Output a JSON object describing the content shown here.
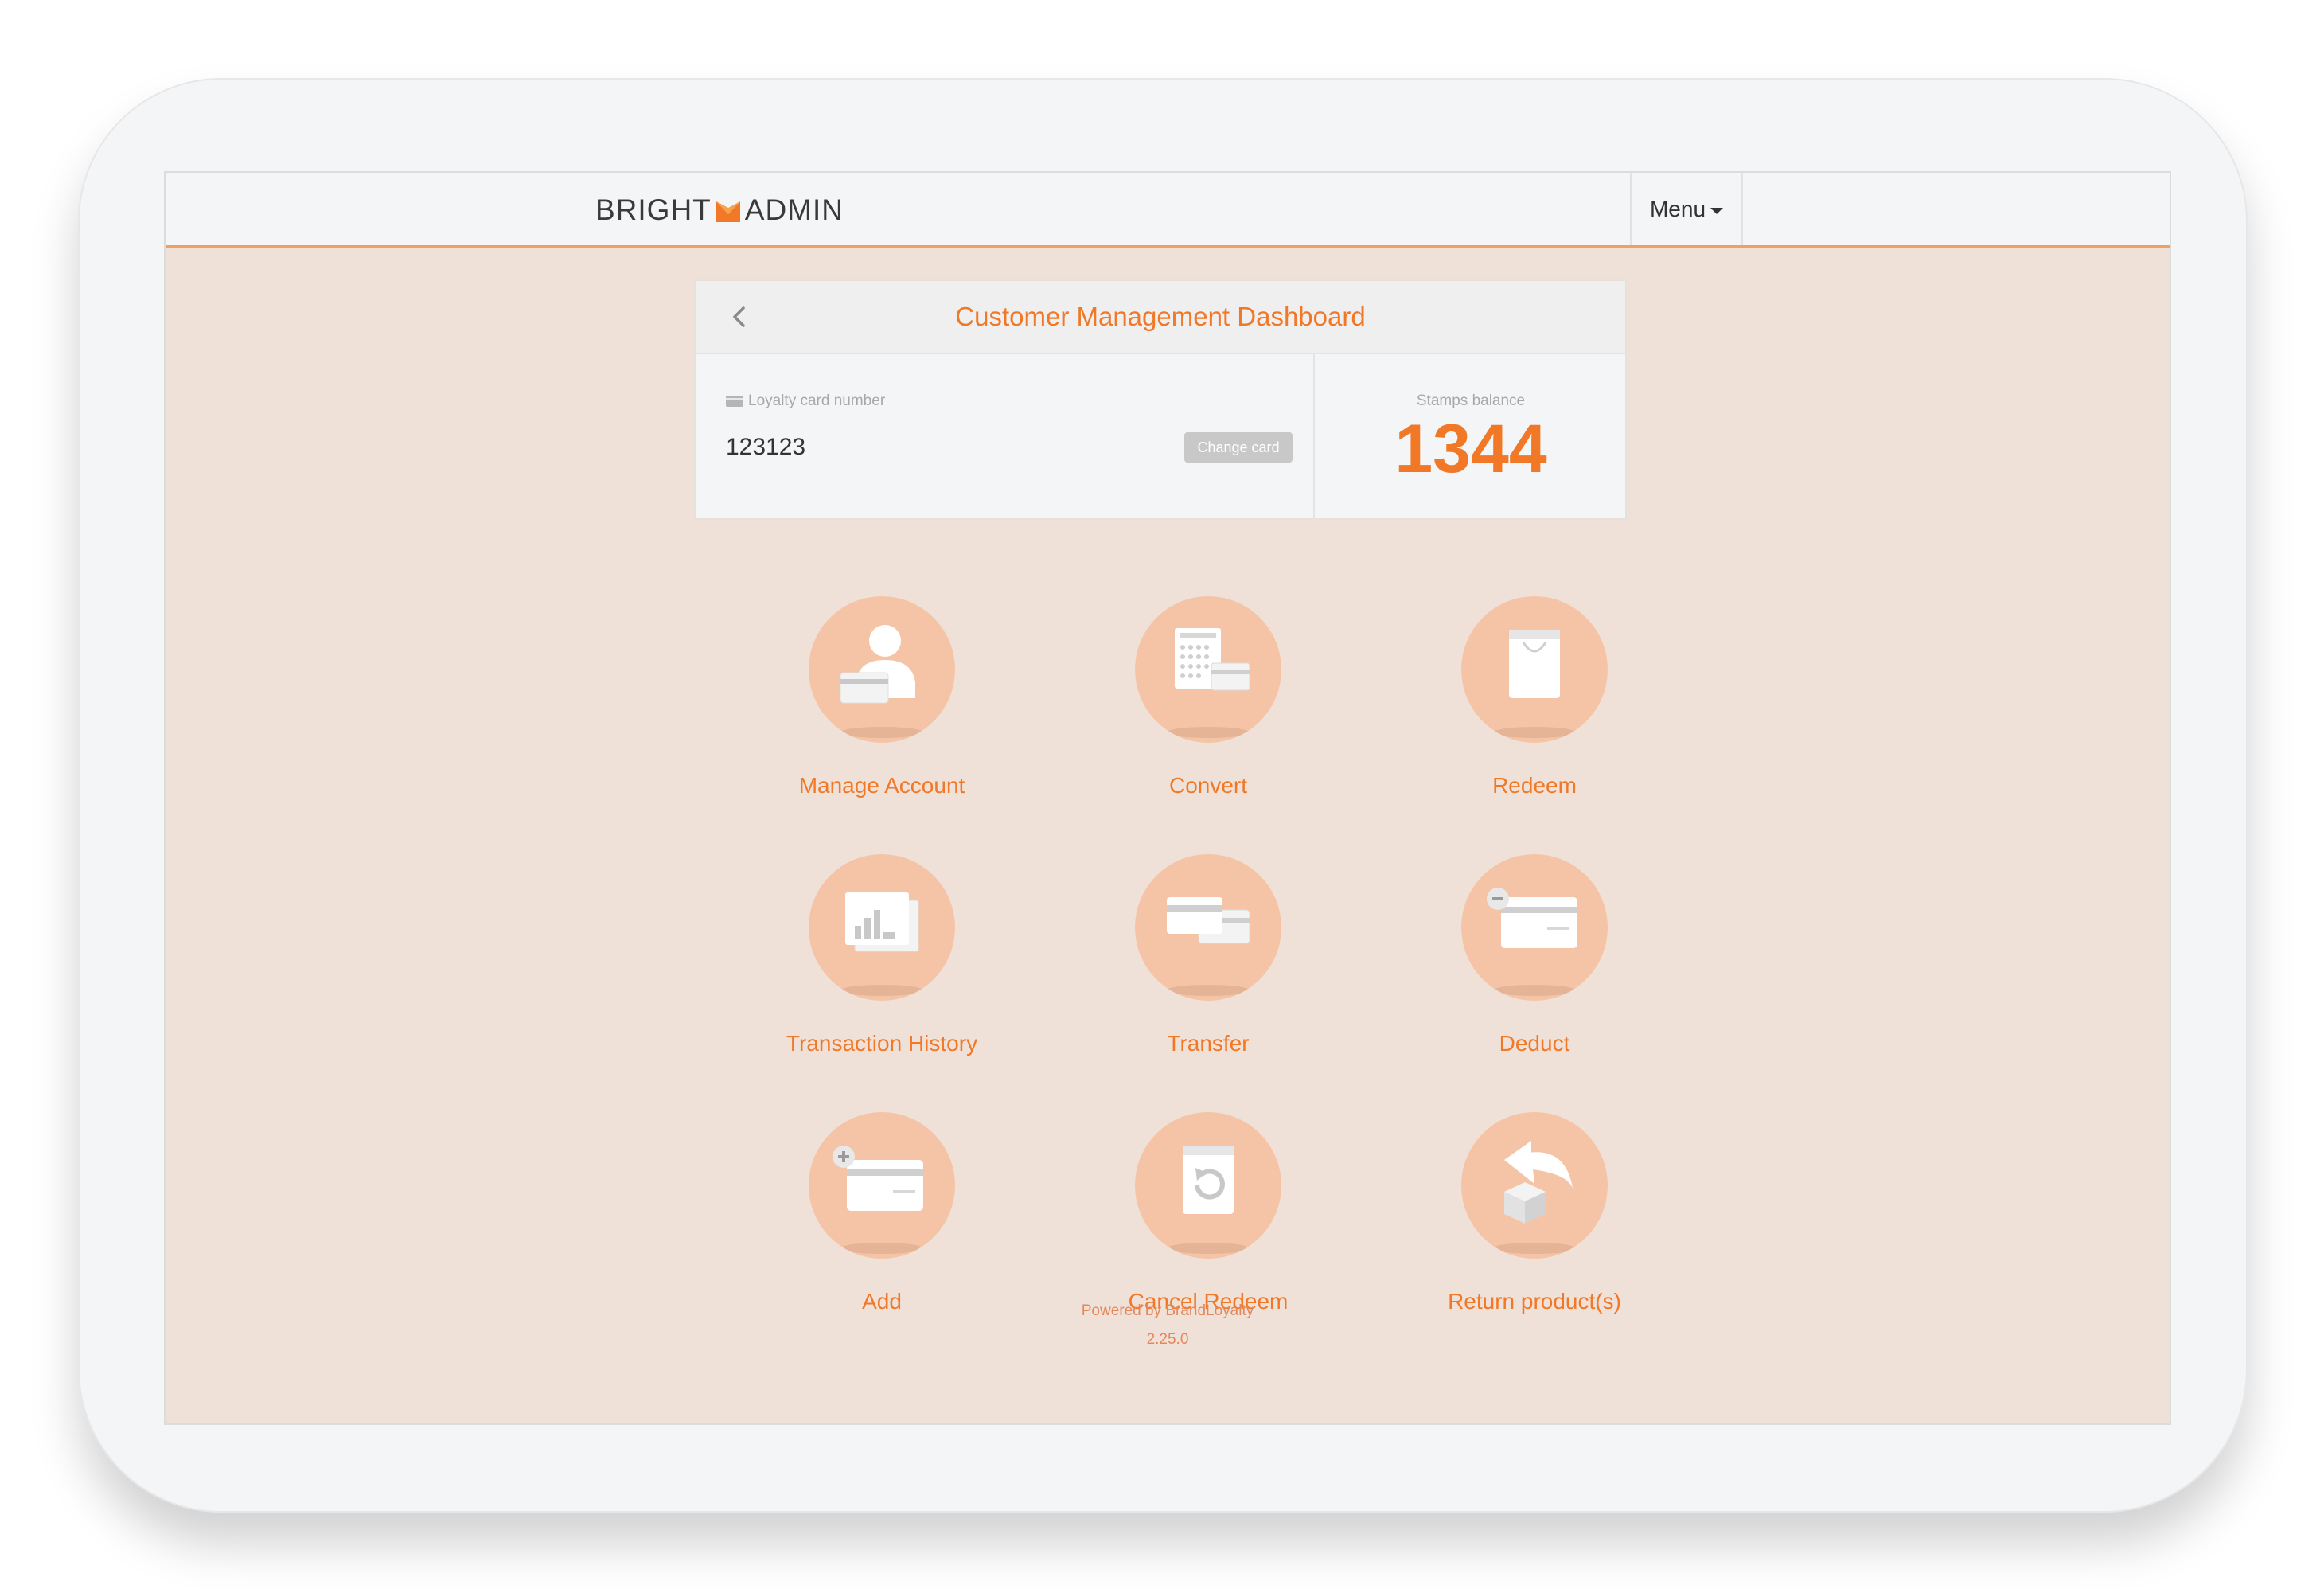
{
  "header": {
    "logo_left": "BRIGHT",
    "logo_right": "ADMIN",
    "menu_label": "Menu"
  },
  "dashboard": {
    "title": "Customer Management Dashboard",
    "card_label": "Loyalty card number",
    "card_number": "123123",
    "change_card_label": "Change card",
    "stamps_label": "Stamps balance",
    "stamps_value": "1344"
  },
  "actions": [
    {
      "label": "Manage Account",
      "icon": "manage-account-icon"
    },
    {
      "label": "Convert",
      "icon": "convert-icon"
    },
    {
      "label": "Redeem",
      "icon": "redeem-icon"
    },
    {
      "label": "Transaction History",
      "icon": "transaction-history-icon"
    },
    {
      "label": "Transfer",
      "icon": "transfer-icon"
    },
    {
      "label": "Deduct",
      "icon": "deduct-icon"
    },
    {
      "label": "Add",
      "icon": "add-icon"
    },
    {
      "label": "Cancel Redeem",
      "icon": "cancel-redeem-icon"
    },
    {
      "label": "Return product(s)",
      "icon": "return-product-icon"
    }
  ],
  "footer": {
    "powered_by": "Powered by BrandLoyalty",
    "version": "2.25.0"
  },
  "colors": {
    "accent": "#f07827",
    "background": "#efe1d8",
    "circle": "#f5c4a6"
  }
}
